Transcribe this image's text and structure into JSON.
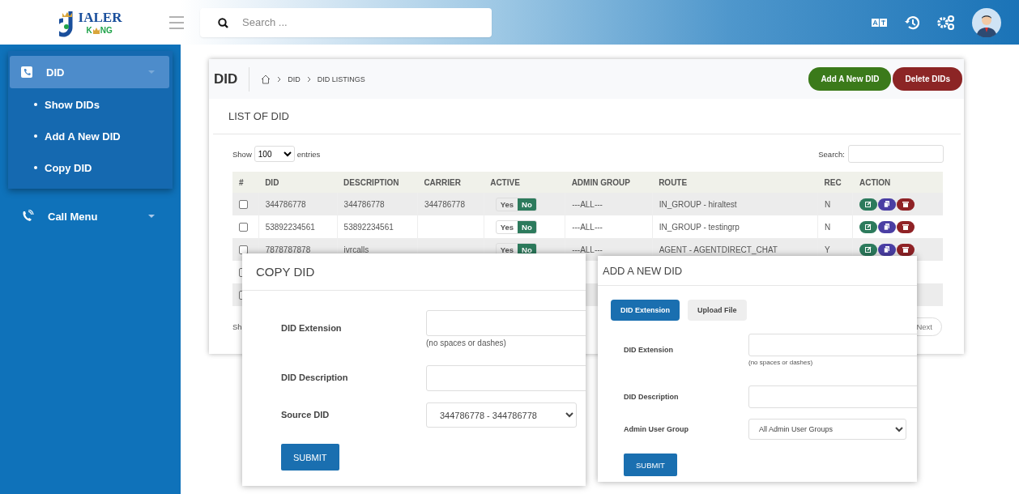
{
  "header": {
    "logo": {
      "word": "IALER",
      "sub_left": "K",
      "sub_right": "NG"
    },
    "search": {
      "placeholder": "Search ..."
    }
  },
  "sidebar": {
    "items": [
      {
        "label": "DID",
        "selected": true,
        "expanded": true,
        "children": [
          {
            "label": "Show DIDs"
          },
          {
            "label": "Add A New DID"
          },
          {
            "label": "Copy DID"
          }
        ]
      },
      {
        "label": "Call Menu",
        "selected": false,
        "expanded": false
      }
    ]
  },
  "page": {
    "title": "DID",
    "breadcrumb": [
      "DID",
      "DID LISTINGS"
    ],
    "buttons": [
      {
        "label": "Add A New DID",
        "kind": "add"
      },
      {
        "label": "Delete DIDs",
        "kind": "delete"
      }
    ]
  },
  "list": {
    "title": "LIST OF DID",
    "show_label": "Show",
    "length": "100",
    "entries_label": "entries",
    "search_label": "Search:",
    "columns": [
      "#",
      "DID",
      "DESCRIPTION",
      "CARRIER",
      "ACTIVE",
      "ADMIN GROUP",
      "ROUTE",
      "REC",
      "ACTION"
    ],
    "rows": [
      {
        "checked": false,
        "did": "344786778",
        "description": "344786778",
        "carrier": "344786778",
        "active": {
          "yes": "Yes",
          "no": "No",
          "on": false
        },
        "admin_group": "---ALL---",
        "route": "IN_GROUP - hiraltest",
        "rec": "N",
        "actions": true
      },
      {
        "checked": false,
        "did": "53892234561",
        "description": "53892234561",
        "active": {
          "yes": "Yes",
          "no": "No",
          "on": false
        },
        "admin_group": "---ALL---",
        "route": "IN_GROUP - testingrp",
        "rec": "N",
        "actions": true
      },
      {
        "checked": false,
        "did": "7878787878",
        "description": "ivrcalls",
        "active": {
          "yes": "Yes",
          "no": "No",
          "on": false
        },
        "admin_group": "---ALL---",
        "route": "AGENT - AGENTDIRECT_CHAT",
        "rec": "Y",
        "actions": true
      },
      {
        "checked": false
      },
      {
        "checked": false
      }
    ],
    "info": "Sh",
    "next": "Next"
  },
  "copy_dialog": {
    "title": "COPY DID",
    "fields": [
      {
        "label": "DID Extension",
        "kind": "text",
        "hint": "(no spaces or dashes)"
      },
      {
        "label": "DID Description",
        "kind": "text"
      },
      {
        "label": "Source DID",
        "kind": "select",
        "value": "344786778 - 344786778"
      }
    ],
    "submit": "SUBMIT"
  },
  "add_dialog": {
    "title": "ADD A NEW DID",
    "tabs": [
      {
        "label": "DID Extension",
        "selected": true
      },
      {
        "label": "Upload File",
        "selected": false
      }
    ],
    "fields": [
      {
        "label": "DID Extension",
        "kind": "text",
        "hint": "(no spaces or dashes)"
      },
      {
        "label": "DID Description",
        "kind": "text"
      },
      {
        "label": "Admin User Group",
        "kind": "select",
        "value": "All Admin User Groups"
      }
    ],
    "submit": "SUBMIT"
  }
}
